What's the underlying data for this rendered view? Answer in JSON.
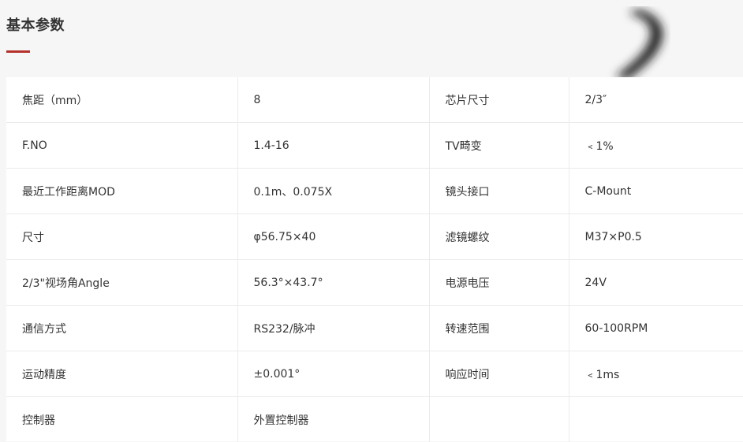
{
  "section": {
    "title": "基本参数"
  },
  "colors": {
    "accent": "#b5312c",
    "background": "#f6f6f6",
    "table_bg": "#ffffff",
    "border": "#ebebeb",
    "text": "#333333"
  },
  "specs": {
    "rows": [
      {
        "label_left": "焦距（mm）",
        "value_left": "8",
        "label_right": "芯片尺寸",
        "value_right": "2/3″"
      },
      {
        "label_left": "F.NO",
        "value_left": "1.4-16",
        "label_right": "TV畸变",
        "value_right": "﹤1%"
      },
      {
        "label_left": "最近工作距离MOD",
        "value_left": "0.1m、0.075X",
        "label_right": "镜头接口",
        "value_right": "C-Mount"
      },
      {
        "label_left": "尺寸",
        "value_left": "φ56.75×40",
        "label_right": "滤镜螺纹",
        "value_right": "M37×P0.5"
      },
      {
        "label_left": "2/3\"视场角Angle",
        "value_left": "56.3°×43.7°",
        "label_right": "电源电压",
        "value_right": "24V"
      },
      {
        "label_left": "通信方式",
        "value_left": "RS232/脉冲",
        "label_right": "转速范围",
        "value_right": "60-100RPM"
      },
      {
        "label_left": "运动精度",
        "value_left": "±0.001°",
        "label_right": "响应时间",
        "value_right": "﹤1ms"
      },
      {
        "label_left": "控制器",
        "value_left": "外置控制器",
        "label_right": "",
        "value_right": ""
      }
    ]
  }
}
